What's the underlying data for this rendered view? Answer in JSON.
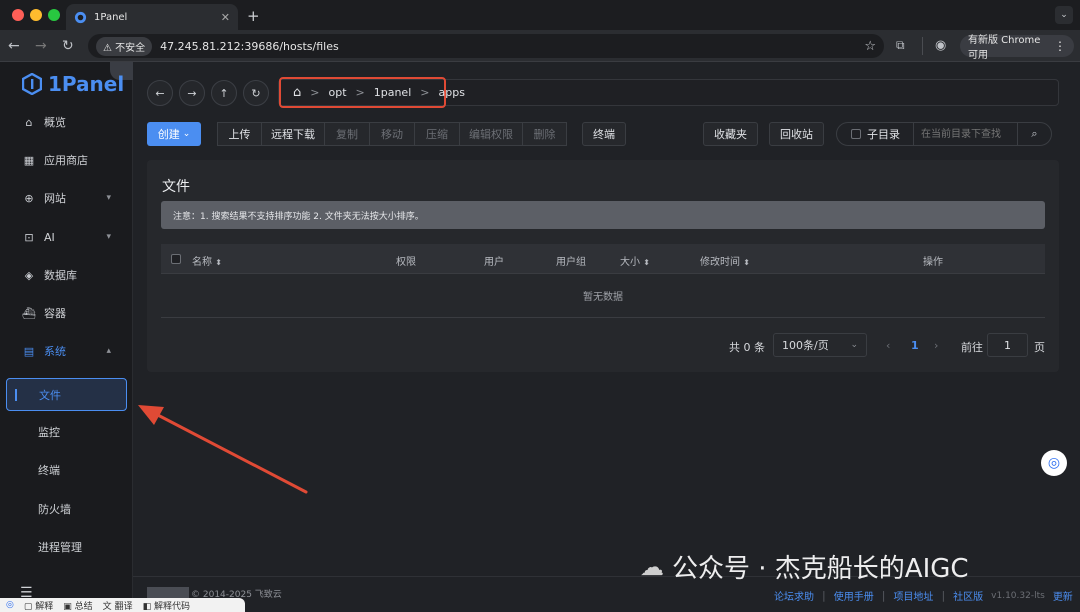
{
  "browser": {
    "tab_title": "1Panel",
    "new_tab": "+",
    "insecure_label": "不安全",
    "url": "47.245.81.212:39686/hosts/files",
    "update_label": "有新版 Chrome 可用"
  },
  "app": {
    "logo_text": "1Panel"
  },
  "sidebar": {
    "items": [
      {
        "label": "概览"
      },
      {
        "label": "应用商店"
      },
      {
        "label": "网站"
      },
      {
        "label": "AI"
      },
      {
        "label": "数据库"
      },
      {
        "label": "容器"
      },
      {
        "label": "系统"
      }
    ],
    "sub_items": [
      {
        "label": "文件"
      },
      {
        "label": "监控"
      },
      {
        "label": "终端"
      },
      {
        "label": "防火墙"
      },
      {
        "label": "进程管理"
      }
    ]
  },
  "breadcrumb": {
    "items": [
      "opt",
      "1panel",
      "apps"
    ],
    "separator": ">"
  },
  "toolbar": {
    "create": "创建",
    "upload": "上传",
    "remote_download": "远程下载",
    "copy": "复制",
    "move": "移动",
    "compress": "压缩",
    "edit_permission": "编辑权限",
    "delete": "删除",
    "terminal": "终端",
    "favorites": "收藏夹",
    "recycle_bin": "回收站",
    "subdir_label": "子目录",
    "search_placeholder": "在当前目录下查找"
  },
  "panel": {
    "title": "文件",
    "notice": "注意：1. 搜索结果不支持排序功能 2. 文件夹无法按大小排序。",
    "columns": [
      "名称",
      "权限",
      "用户",
      "用户组",
      "大小",
      "修改时间",
      "操作"
    ],
    "empty_text": "暂无数据"
  },
  "pagination": {
    "total_text": "共 0 条",
    "page_size": "100条/页",
    "current_page": "1",
    "goto_label": "前往",
    "goto_value": "1",
    "page_suffix": "页"
  },
  "footer": {
    "copyright": "© 2014-2025 飞致云",
    "links": [
      "论坛求助",
      "使用手册",
      "项目地址",
      "社区版",
      "v1.10.32-lts",
      "更新"
    ]
  },
  "watermark": {
    "text": "公众号 · 杰克船长的AIGC"
  },
  "bottom_bar": {
    "items": [
      "解释",
      "总结",
      "翻译",
      "解释代码"
    ]
  },
  "colors": {
    "accent": "#4b8ef1",
    "highlight_box": "#e04a35",
    "arrow": "#e04a35"
  }
}
